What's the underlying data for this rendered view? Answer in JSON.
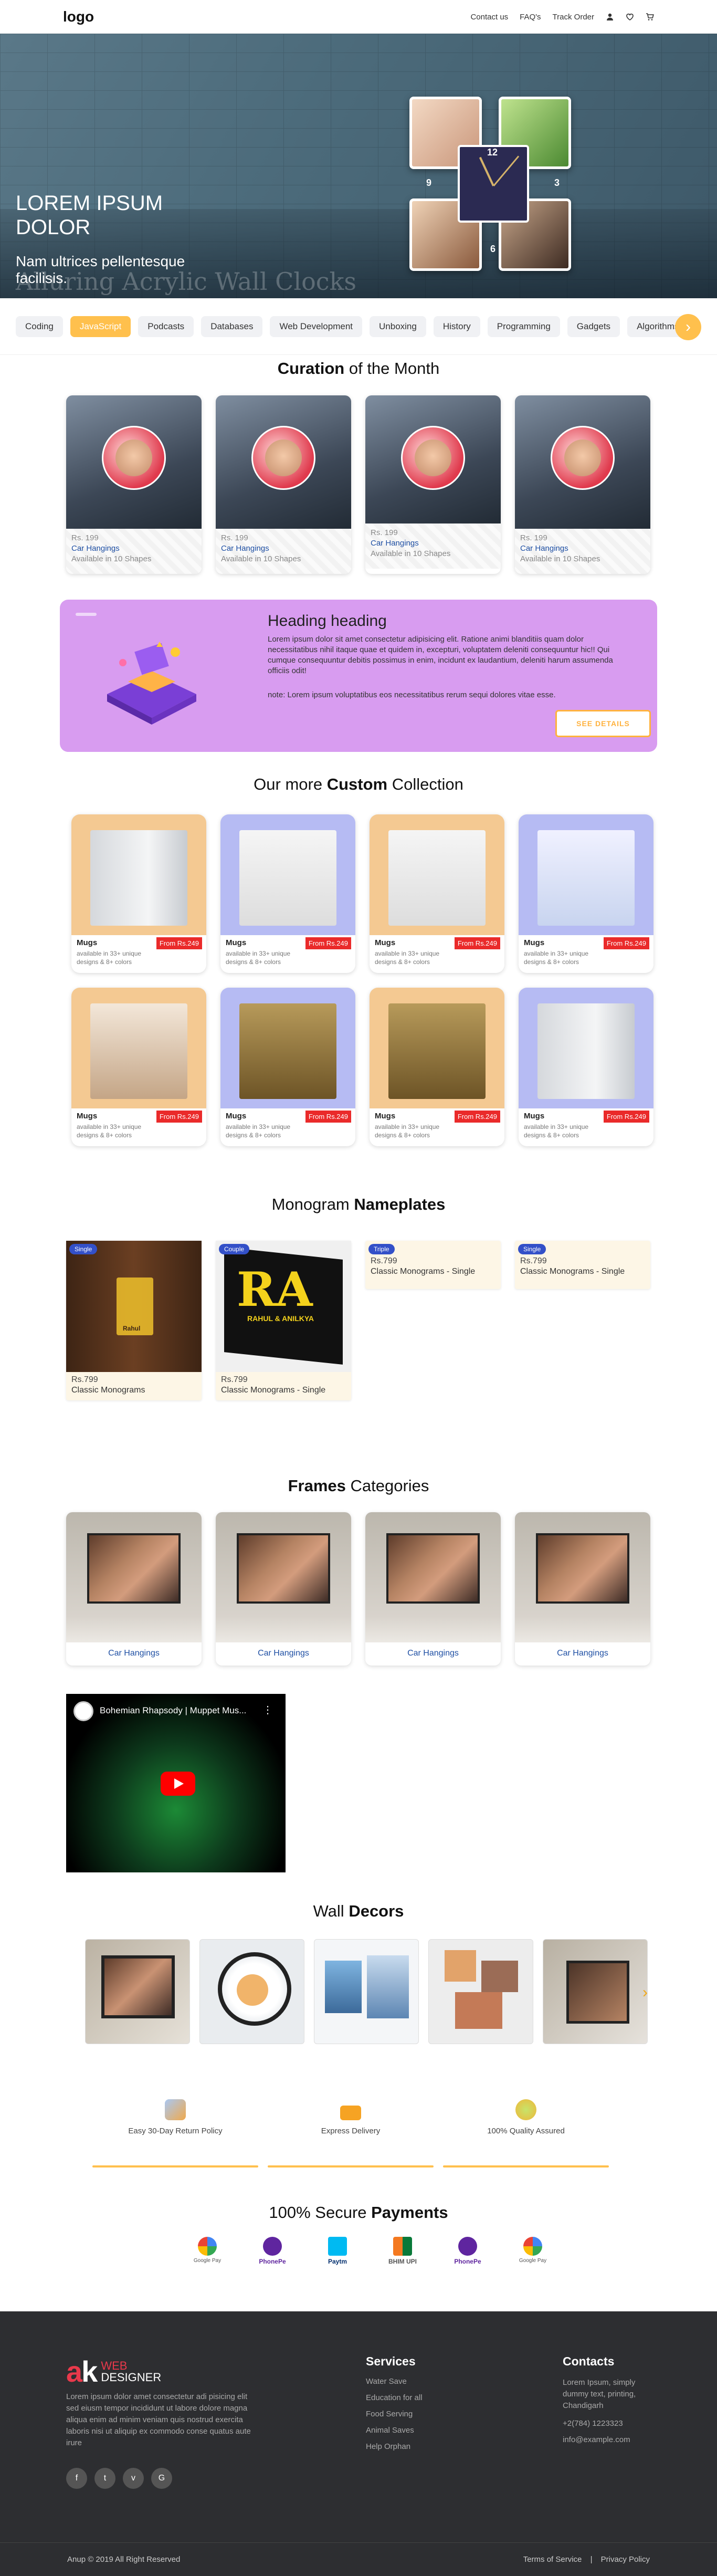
{
  "header": {
    "logo": "logo",
    "nav": [
      "Contact us",
      "FAQ's",
      "Track Order"
    ]
  },
  "hero": {
    "title": "LOREM IPSUM DOLOR",
    "subtitle": "Nam ultrices pellentesque facilisis.",
    "ghost_text": "Alluring Acrylic Wall Clocks"
  },
  "categories": {
    "items": [
      "Coding",
      "JavaScript",
      "Podcasts",
      "Databases",
      "Web Development",
      "Unboxing",
      "History",
      "Programming",
      "Gadgets",
      "Algorithms"
    ],
    "active_index": 1
  },
  "curation": {
    "title_bold": "Curation",
    "title_rest": " of the Month",
    "cards": [
      {
        "price": "Rs. 199",
        "name": "Car Hangings",
        "avail": "Available in 10 Shapes"
      },
      {
        "price": "Rs. 199",
        "name": "Car Hangings",
        "avail": "Available in 10 Shapes"
      },
      {
        "price": "Rs. 199",
        "name": "Car Hangings",
        "avail": "Available in 10 Shapes"
      },
      {
        "price": "Rs. 199",
        "name": "Car Hangings",
        "avail": "Available in 10 Shapes"
      }
    ]
  },
  "banner": {
    "heading": "Heading heading",
    "body": "Lorem ipsum dolor sit amet consectetur adipisicing elit. Ratione animi blanditiis quam dolor necessitatibus nihil itaque quae et quidem in, excepturi, voluptatem deleniti consequuntur hic!! Qui cumque consequuntur debitis possimus in enim, incidunt ex laudantium, deleniti harum assumenda officiis odit!",
    "note": "note: Lorem ipsum voluptatibus eos necessitatibus rerum sequi dolores vitae esse.",
    "button": "SEE DETAILS"
  },
  "custom": {
    "title_pre": "Our more ",
    "title_bold": "Custom",
    "title_post": " Collection",
    "cards": [
      {
        "name": "Mugs",
        "tag": "From Rs.249",
        "desc": "available in 33+ unique designs & 8+ colors",
        "bg": "tan"
      },
      {
        "name": "Mugs",
        "tag": "From Rs.249",
        "desc": "available in 33+ unique designs & 8+ colors",
        "bg": "blue"
      },
      {
        "name": "Mugs",
        "tag": "From Rs.249",
        "desc": "available in 33+ unique designs & 8+ colors",
        "bg": "tan"
      },
      {
        "name": "Mugs",
        "tag": "From Rs.249",
        "desc": "available in 33+ unique designs & 8+ colors",
        "bg": "blue"
      },
      {
        "name": "Mugs",
        "tag": "From Rs.249",
        "desc": "available in 33+ unique designs & 8+ colors",
        "bg": "tan"
      },
      {
        "name": "Mugs",
        "tag": "From Rs.249",
        "desc": "available in 33+ unique designs & 8+ colors",
        "bg": "blue"
      },
      {
        "name": "Mugs",
        "tag": "From Rs.249",
        "desc": "available in 33+ unique designs & 8+ colors",
        "bg": "tan"
      },
      {
        "name": "Mugs",
        "tag": "From Rs.249",
        "desc": "available in 33+ unique designs & 8+ colors",
        "bg": "blue"
      }
    ]
  },
  "monogram": {
    "title_pre": "Monogram ",
    "title_bold": "Nameplates",
    "cards": [
      {
        "badge": "Single",
        "price": "Rs.799",
        "title": "Classic Monograms",
        "door_text": "Rahul"
      },
      {
        "badge": "Couple",
        "price": "Rs.799",
        "title": "Classic Monograms - Single",
        "plate_text": "RAHUL & ANILKYA"
      },
      {
        "badge": "Triple",
        "price": "Rs.799",
        "title": "Classic Monograms - Single"
      },
      {
        "badge": "Single",
        "price": "Rs.799",
        "title": "Classic Monograms - Single"
      }
    ]
  },
  "frames": {
    "title_bold": "Frames",
    "title_rest": " Categories",
    "cards": [
      "Car Hangings",
      "Car Hangings",
      "Car Hangings",
      "Car Hangings"
    ]
  },
  "video": {
    "title": "Bohemian Rhapsody | Muppet Mus..."
  },
  "wall_decor": {
    "title_pre": "Wall ",
    "title_bold": "Decors"
  },
  "features": [
    "Easy 30-Day Return Policy",
    "Express Delivery",
    "100% Quality Assured"
  ],
  "payments": {
    "title_pre": "100% Secure ",
    "title_bold": "Payments",
    "methods": [
      "Google Pay",
      "PhonePe",
      "Paytm",
      "BHIM UPI",
      "PhonePe",
      "Google Pay"
    ]
  },
  "footer": {
    "brand_web": "WEB",
    "brand_designer": "DESIGNER",
    "about": "Lorem ipsum dolor amet consectetur adi pisicing elit sed eiusm tempor incididunt ut labore dolore magna aliqua enim ad minim veniam quis nostrud exercita laboris nisi ut aliquip ex commodo conse quatus aute irure",
    "services_title": "Services",
    "services": [
      "Water Save",
      "Education for all",
      "Food Serving",
      "Animal Saves",
      "Help Orphan"
    ],
    "contacts_title": "Contacts",
    "address": "Lorem Ipsum, simply dummy text, printing, Chandigarh",
    "phone": "+2(784) 1223323",
    "email": "info@example.com",
    "copyright": "Anup © 2019 All Right Reserved",
    "terms": "Terms of Service",
    "privacy": "Privacy Policy"
  }
}
